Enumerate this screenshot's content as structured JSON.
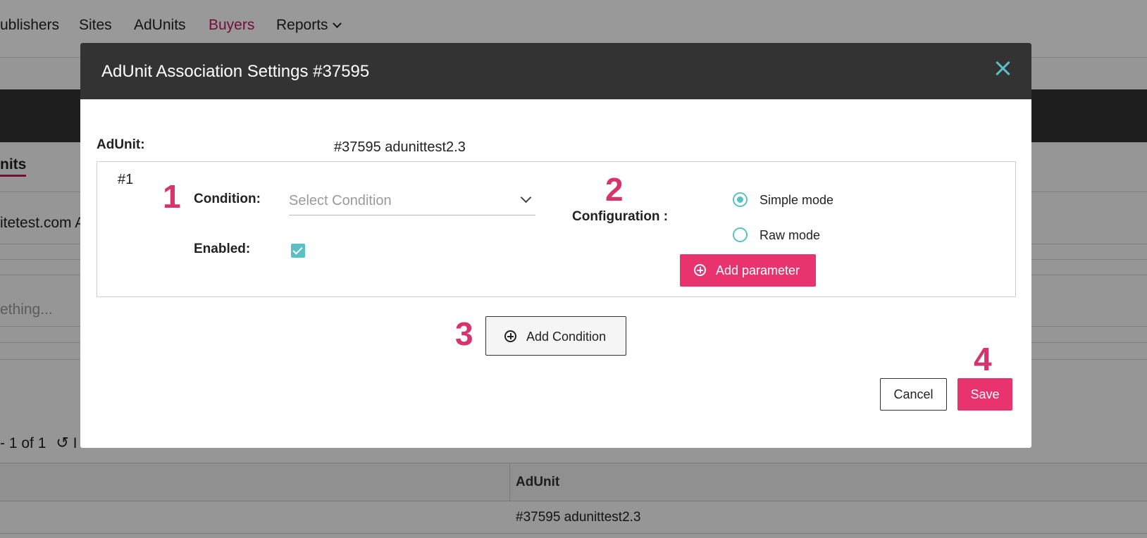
{
  "background": {
    "nav": {
      "items": [
        {
          "label": "ublishers"
        },
        {
          "label": "Sites"
        },
        {
          "label": "AdUnits"
        },
        {
          "label": "Buyers",
          "active": true
        },
        {
          "label": "Reports",
          "has_dropdown": true
        }
      ]
    },
    "tab_label": "nits",
    "site_text": "itetest.com A",
    "search_placeholder": "ething...",
    "pager_text": "- 1 of 1",
    "pager_trailing": "I",
    "table": {
      "header": "AdUnit",
      "row_value": "#37595 adunittest2.3"
    }
  },
  "modal": {
    "title": "AdUnit Association Settings #37595",
    "adunit_label": "AdUnit:",
    "adunit_value": "#37595 adunittest2.3",
    "condition_block": {
      "index": "#1",
      "condition_label": "Condition:",
      "condition_placeholder": "Select Condition",
      "enabled_label": "Enabled:",
      "enabled_checked": true,
      "configuration_label": "Configuration :",
      "modes": [
        {
          "label": "Simple mode",
          "checked": true
        },
        {
          "label": "Raw mode",
          "checked": false
        }
      ],
      "add_parameter_label": "Add parameter"
    },
    "add_condition_label": "Add Condition",
    "cancel_label": "Cancel",
    "save_label": "Save"
  },
  "annotations": {
    "m1": "1",
    "m2": "2",
    "m3": "3",
    "m4": "4"
  },
  "colors": {
    "accent_pink": "#e8336f",
    "marker_pink": "#d6346e",
    "teal": "#5bc0c6",
    "header_dark": "#333333"
  },
  "icons": [
    "close-icon",
    "chevron-down-icon",
    "check-icon",
    "plus-circle-icon",
    "refresh-icon"
  ]
}
